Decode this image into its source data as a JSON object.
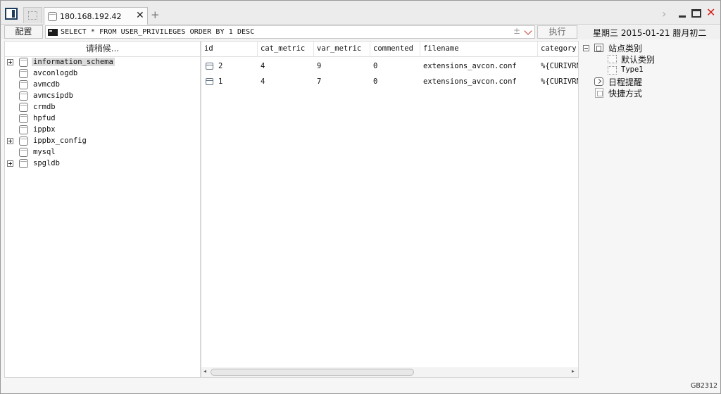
{
  "tab": {
    "label": "180.168.192.42"
  },
  "toolbar": {
    "config_label": "配置",
    "query_text": "SELECT * FROM USER_PRIVILEGES ORDER BY 1 DESC",
    "plusminus": "±",
    "run_label": "执行"
  },
  "date": "星期三 2015-01-21 腊月初二",
  "left_panel": {
    "header": "请稍候...",
    "databases": [
      {
        "name": "information_schema",
        "expandable": true,
        "selected": true
      },
      {
        "name": "avconlogdb",
        "expandable": false
      },
      {
        "name": "avmcdb",
        "expandable": false
      },
      {
        "name": "avmcsipdb",
        "expandable": false
      },
      {
        "name": "crmdb",
        "expandable": false
      },
      {
        "name": "hpfud",
        "expandable": false
      },
      {
        "name": "ippbx",
        "expandable": false
      },
      {
        "name": "ippbx_config",
        "expandable": true
      },
      {
        "name": "mysql",
        "expandable": false
      },
      {
        "name": "spgldb",
        "expandable": true
      }
    ]
  },
  "grid": {
    "columns": [
      "id",
      "cat_metric",
      "var_metric",
      "commented",
      "filename",
      "category"
    ],
    "rows": [
      [
        "2",
        "4",
        "9",
        "0",
        "extensions_avcon.conf",
        "%{CURIVRN"
      ],
      [
        "1",
        "4",
        "7",
        "0",
        "extensions_avcon.conf",
        "%{CURIVRN"
      ]
    ]
  },
  "right_panel": {
    "root": "站点类别",
    "categories": [
      "默认类别",
      "Type1"
    ],
    "reminder": "日程提醒",
    "shortcuts": "快捷方式"
  },
  "status": {
    "encoding": "GB2312"
  },
  "colors": {
    "close_red": "#d4201b",
    "toggle_navy": "#1d3d5c"
  }
}
